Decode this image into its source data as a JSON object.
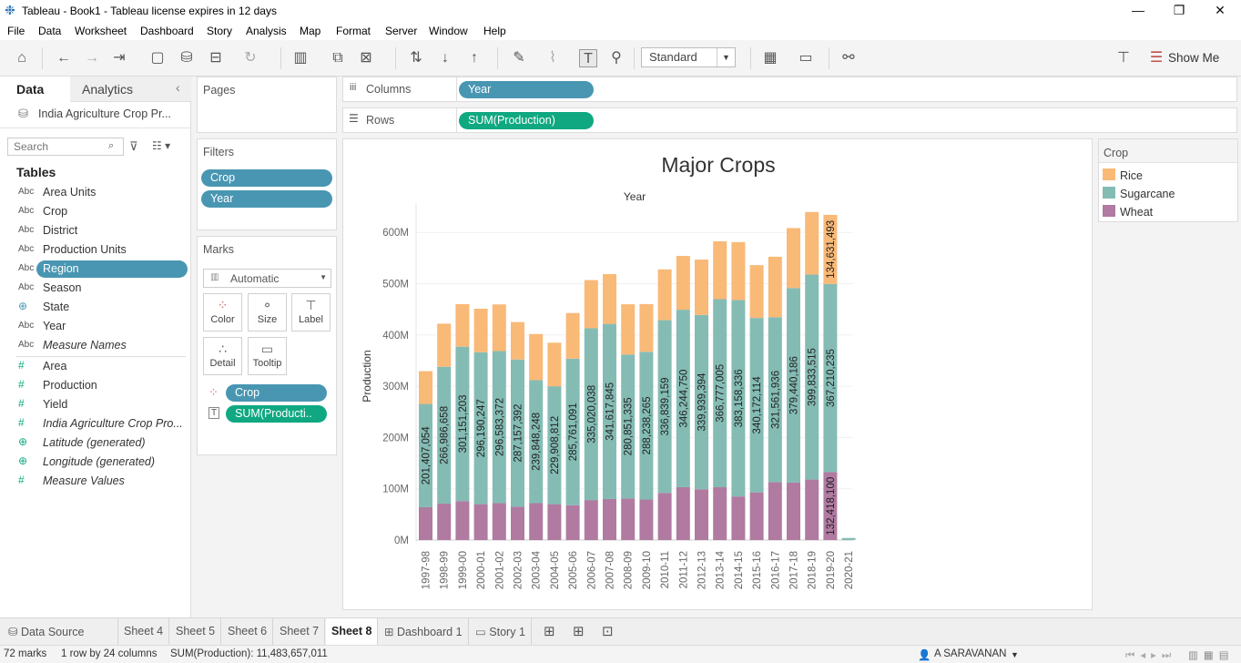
{
  "window": {
    "title": "Tableau - Book1 - Tableau license expires in 12 days"
  },
  "menu": [
    "File",
    "Data",
    "Worksheet",
    "Dashboard",
    "Story",
    "Analysis",
    "Map",
    "Format",
    "Server",
    "Window",
    "Help"
  ],
  "toolbar": {
    "fit_mode": "Standard",
    "show_me": "Show Me"
  },
  "left": {
    "tab_data": "Data",
    "tab_analytics": "Analytics",
    "datasource": "India Agriculture Crop Pr...",
    "search_placeholder": "Search",
    "tables_heading": "Tables",
    "dimensions": [
      {
        "type": "Abc",
        "name": "Area Units"
      },
      {
        "type": "Abc",
        "name": "Crop"
      },
      {
        "type": "Abc",
        "name": "District"
      },
      {
        "type": "Abc",
        "name": "Production Units"
      },
      {
        "type": "Abc",
        "name": "Region"
      },
      {
        "type": "Abc",
        "name": "Season"
      },
      {
        "type": "globe",
        "name": "State"
      },
      {
        "type": "Abc",
        "name": "Year"
      },
      {
        "type": "Abc",
        "name": "Measure Names"
      }
    ],
    "measures": [
      {
        "type": "#",
        "name": "Area"
      },
      {
        "type": "#",
        "name": "Production"
      },
      {
        "type": "#",
        "name": "Yield"
      },
      {
        "type": "#",
        "name": "India Agriculture Crop Pro..."
      },
      {
        "type": "globe",
        "name": "Latitude (generated)"
      },
      {
        "type": "globe",
        "name": "Longitude (generated)"
      },
      {
        "type": "#",
        "name": "Measure Values"
      }
    ]
  },
  "cards": {
    "pages": "Pages",
    "filters": "Filters",
    "filter_pills": [
      "Crop",
      "Year"
    ],
    "marks": "Marks",
    "mark_type": "Automatic",
    "mark_buttons": [
      "Color",
      "Size",
      "Label",
      "Detail",
      "Tooltip"
    ],
    "mark_pills": [
      "Crop",
      "SUM(Producti.."
    ]
  },
  "shelves": {
    "columns_label": "Columns",
    "columns_pill": "Year",
    "rows_label": "Rows",
    "rows_pill": "SUM(Production)"
  },
  "legend": {
    "title": "Crop",
    "items": [
      {
        "name": "Rice",
        "color": "#f9b977"
      },
      {
        "name": "Sugarcane",
        "color": "#84bcb4"
      },
      {
        "name": "Wheat",
        "color": "#b07aa1"
      }
    ]
  },
  "chart_data": {
    "type": "bar",
    "stacked": true,
    "title": "Major Crops",
    "xlabel": "Year",
    "ylabel": "Production",
    "ylim": [
      0,
      680000000
    ],
    "yticks": [
      "0M",
      "100M",
      "200M",
      "300M",
      "400M",
      "500M",
      "600M"
    ],
    "categories": [
      "1997-98",
      "1998-99",
      "1999-00",
      "2000-01",
      "2001-02",
      "2002-03",
      "2003-04",
      "2004-05",
      "2005-06",
      "2006-07",
      "2007-08",
      "2008-09",
      "2009-10",
      "2010-11",
      "2011-12",
      "2012-13",
      "2013-14",
      "2014-15",
      "2015-16",
      "2016-17",
      "2017-18",
      "2018-19",
      "2019-20",
      "2020-21"
    ],
    "series": [
      {
        "name": "Wheat",
        "color": "#b07aa1",
        "values": [
          64000000,
          71000000,
          76000000,
          70000000,
          72000000,
          65000000,
          72000000,
          70000000,
          68000000,
          78000000,
          80000000,
          81000000,
          79000000,
          92000000,
          103000000,
          99000000,
          103000000,
          85000000,
          93000000,
          113000000,
          112000000,
          118000000,
          132418100,
          0
        ]
      },
      {
        "name": "Sugarcane",
        "color": "#84bcb4",
        "values": [
          201407054,
          266986658,
          301151203,
          296190247,
          296583372,
          287157392,
          239848248,
          229908812,
          285761091,
          335020038,
          341617845,
          280851335,
          288238265,
          336839159,
          346244750,
          339939394,
          366777005,
          383158336,
          340172114,
          321561936,
          379440186,
          399833515,
          367210235,
          4000000
        ],
        "labels": [
          "201,407,054",
          "266,986,658",
          "301,151,203",
          "296,190,247",
          "296,583,372",
          "287,157,392",
          "239,848,248",
          "229,908,812",
          "285,761,091",
          "335,020,038",
          "341,617,845",
          "280,851,335",
          "288,238,265",
          "336,839,159",
          "346,244,750",
          "339,939,394",
          "366,777,005",
          "383,158,336",
          "340,172,114",
          "321,561,936",
          "379,440,186",
          "399,833,515",
          "367,210,235",
          ""
        ]
      },
      {
        "name": "Rice",
        "color": "#f9b977",
        "values": [
          64000000,
          84000000,
          83000000,
          85000000,
          91000000,
          73000000,
          90000000,
          85000000,
          89000000,
          94000000,
          97000000,
          98000000,
          93000000,
          99000000,
          105000000,
          108000000,
          113000000,
          113000000,
          103000000,
          118000000,
          117000000,
          122000000,
          134631493,
          0
        ]
      }
    ],
    "point_labels": {
      "rice_2019_20": "134,631,493",
      "wheat_2019_20": "132,418,100"
    }
  },
  "sheet_tabs": [
    "Data Source",
    "Sheet 4",
    "Sheet 5",
    "Sheet 6",
    "Sheet 7",
    "Sheet 8",
    "Dashboard 1",
    "Story 1"
  ],
  "status": {
    "marks": "72 marks",
    "rows": "1 row by 24 columns",
    "sum": "SUM(Production): 11,483,657,011",
    "user": "A SARAVANAN"
  }
}
